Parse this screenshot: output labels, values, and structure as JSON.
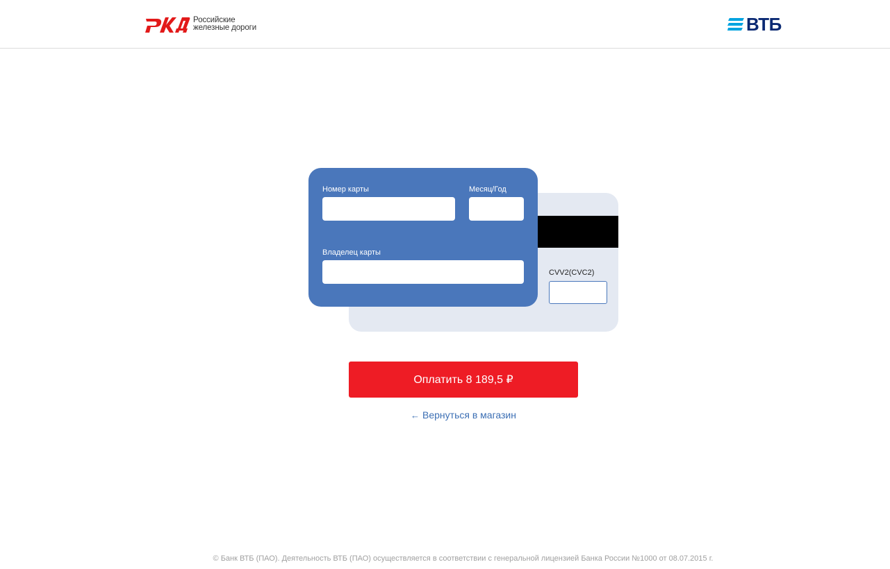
{
  "header": {
    "rzd_logo": {
      "line1": "Российские",
      "line2": "железные дороги",
      "mark_color": "#e21a1a"
    },
    "vtb_logo": {
      "text": "ВТБ",
      "color": "#0a2973",
      "stripe_color": "#00a3e0"
    }
  },
  "card_front": {
    "number_label": "Номер карты",
    "expiry_label": "Месяц/Год",
    "holder_label": "Владелец карты",
    "color": "#4a77bb"
  },
  "card_back": {
    "cvv_label": "CVV2(CVC2)",
    "color": "#e4e9f2"
  },
  "actions": {
    "pay_label": "Оплатить 8 189,5 ₽",
    "back_arrow": "←",
    "back_label": "Вернуться в магазин",
    "pay_color": "#ee1c25"
  },
  "footer": {
    "text": "© Банк ВТБ (ПАО). Деятельность ВТБ (ПАО) осуществляется в соответствии с генеральной лицензией Банка России №1000 от 08.07.2015 г."
  }
}
